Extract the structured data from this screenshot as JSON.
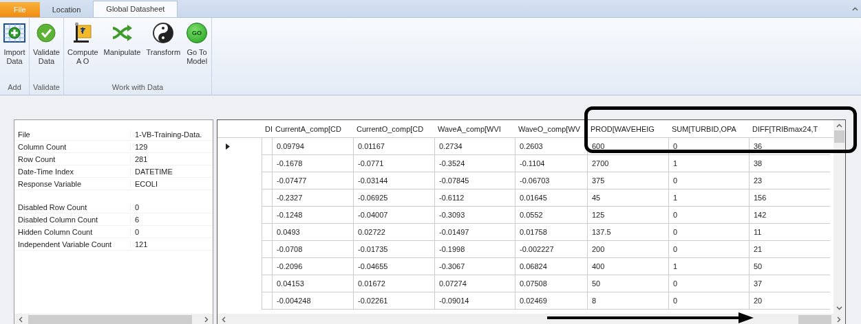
{
  "ribbon": {
    "tabs": [
      {
        "label": "File",
        "kind": "file",
        "selected": false
      },
      {
        "label": "Location",
        "kind": "tab",
        "selected": false
      },
      {
        "label": "Global Datasheet",
        "kind": "tab",
        "selected": true
      }
    ],
    "groups": [
      {
        "label": "Add",
        "buttons": [
          {
            "label": "Import\nData",
            "kind": "import"
          }
        ]
      },
      {
        "label": "Validate",
        "buttons": [
          {
            "label": "Validate\nData",
            "kind": "validate"
          }
        ]
      },
      {
        "label": "Work with Data",
        "buttons": [
          {
            "label": "Compute\nA O",
            "kind": "compute"
          },
          {
            "label": "Manipulate",
            "kind": "manipulate"
          },
          {
            "label": "Transform",
            "kind": "transform"
          },
          {
            "label": "Go To\nModel",
            "kind": "go",
            "icon_text": "GO"
          }
        ]
      }
    ]
  },
  "properties": {
    "groups": [
      [
        {
          "label": "File",
          "value": "1-VB-Training-Data."
        },
        {
          "label": "Column Count",
          "value": "129"
        },
        {
          "label": "Row Count",
          "value": "281"
        },
        {
          "label": "Date-Time Index",
          "value": "DATETIME"
        },
        {
          "label": "Response Variable",
          "value": "ECOLI"
        }
      ],
      [
        {
          "label": "Disabled Row Count",
          "value": "0"
        },
        {
          "label": "Disabled Column Count",
          "value": "6"
        },
        {
          "label": "Hidden Column Count",
          "value": "0"
        },
        {
          "label": "Independent Variable Count",
          "value": "121"
        }
      ]
    ]
  },
  "grid": {
    "columns": [
      "DI",
      "CurrentA_comp[CD",
      "CurrentO_comp[CD",
      "WaveA_comp[WVI",
      "WaveO_comp[WV",
      "PROD[WAVEHEIG",
      "SUM[TURBID,OPA",
      "DIFF[TRIBmax24,T"
    ],
    "rows": [
      {
        "current": true,
        "cells": [
          "",
          "0.09794",
          "0.01167",
          "0.2734",
          "0.2603",
          "600",
          "0",
          "36"
        ]
      },
      {
        "current": false,
        "cells": [
          "",
          "-0.1678",
          "-0.0771",
          "-0.3524",
          "-0.1104",
          "2700",
          "1",
          "38"
        ]
      },
      {
        "current": false,
        "cells": [
          "",
          "-0.07477",
          "-0.03144",
          "-0.07845",
          "-0.06703",
          "375",
          "0",
          "23"
        ]
      },
      {
        "current": false,
        "cells": [
          "",
          "-0.2327",
          "-0.06925",
          "-0.6112",
          "0.01645",
          "45",
          "1",
          "156"
        ]
      },
      {
        "current": false,
        "cells": [
          "",
          "-0.1248",
          "-0.04007",
          "-0.3093",
          "0.0552",
          "125",
          "0",
          "142"
        ]
      },
      {
        "current": false,
        "cells": [
          "",
          "0.0493",
          "0.02722",
          "-0.01497",
          "0.01758",
          "137.5",
          "0",
          "11"
        ]
      },
      {
        "current": false,
        "cells": [
          "",
          "-0.0708",
          "-0.01735",
          "-0.1998",
          "-0.002227",
          "200",
          "0",
          "21"
        ]
      },
      {
        "current": false,
        "cells": [
          "",
          "-0.2096",
          "-0.04655",
          "-0.3067",
          "0.06824",
          "400",
          "1",
          "50"
        ]
      },
      {
        "current": false,
        "cells": [
          "",
          "0.04153",
          "0.01672",
          "0.07274",
          "0.07508",
          "50",
          "0",
          "37"
        ]
      },
      {
        "current": false,
        "cells": [
          "",
          "-0.004248",
          "-0.02261",
          "-0.09014",
          "0.02469",
          "8",
          "0",
          "20"
        ]
      }
    ]
  }
}
